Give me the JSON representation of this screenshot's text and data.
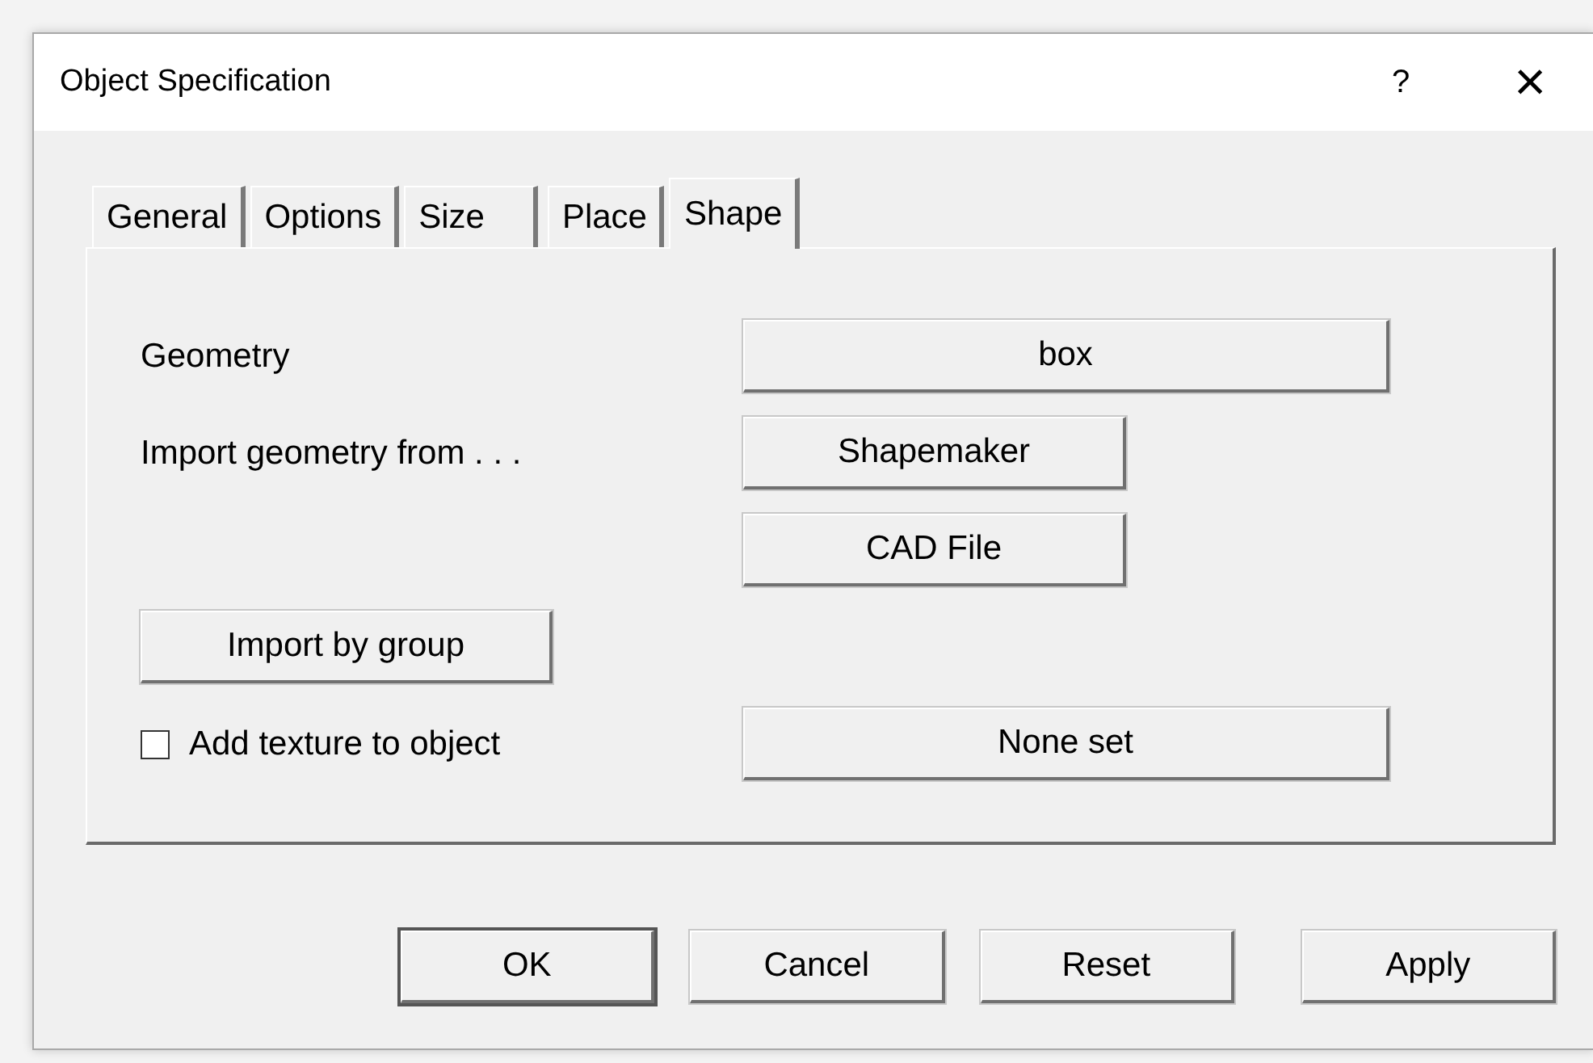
{
  "window": {
    "title": "Object Specification",
    "help": "?",
    "close": "×"
  },
  "tabs": [
    {
      "label": "General",
      "selected": false
    },
    {
      "label": "Options",
      "selected": false
    },
    {
      "label": "Size",
      "selected": false
    },
    {
      "label": "Place",
      "selected": false
    },
    {
      "label": "Shape",
      "selected": true
    }
  ],
  "geometry": {
    "label": "Geometry",
    "button": "box"
  },
  "import": {
    "label": "Import geometry from . . .",
    "buttons": [
      "Shapemaker",
      "CAD File"
    ]
  },
  "import_by_group": "Import by group",
  "texture": {
    "label": "Add texture to object",
    "checked": false,
    "button": "None set"
  },
  "buttons": [
    {
      "label": "OK",
      "default": true
    },
    {
      "label": "Cancel",
      "default": false
    },
    {
      "label": "Reset",
      "default": false
    },
    {
      "label": "Apply",
      "default": false
    }
  ]
}
